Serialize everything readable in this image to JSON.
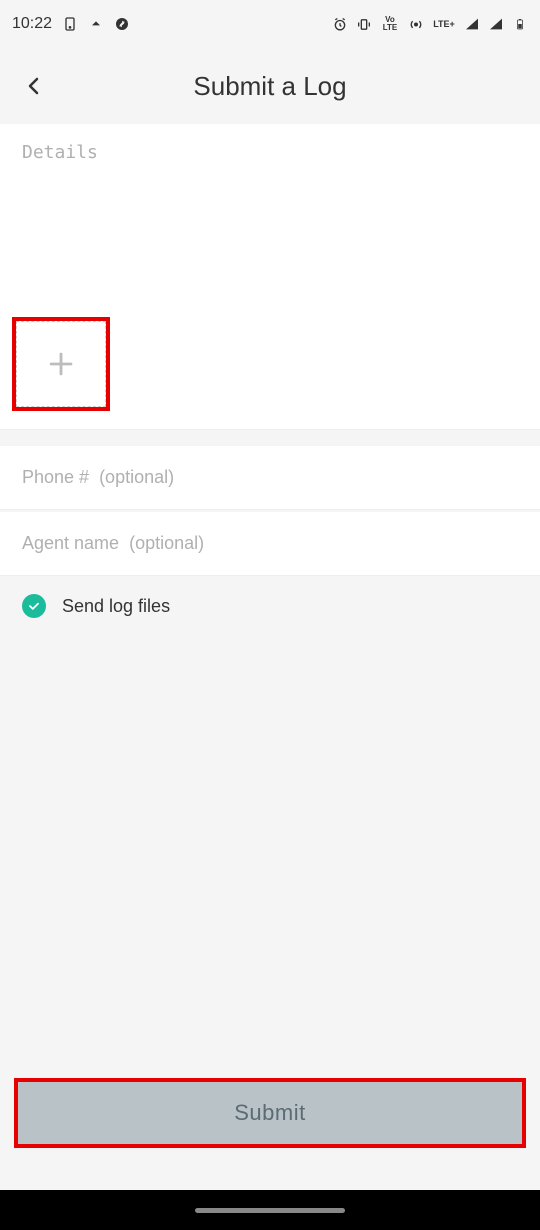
{
  "status": {
    "time": "10:22",
    "lte": "LTE+",
    "volte": "Vo LTE"
  },
  "header": {
    "title": "Submit a Log"
  },
  "form": {
    "details_placeholder": "Details",
    "phone_placeholder": "Phone #  (optional)",
    "agent_placeholder": "Agent name  (optional)",
    "send_logs_label": "Send log files",
    "send_logs_checked": true,
    "submit_label": "Submit"
  }
}
